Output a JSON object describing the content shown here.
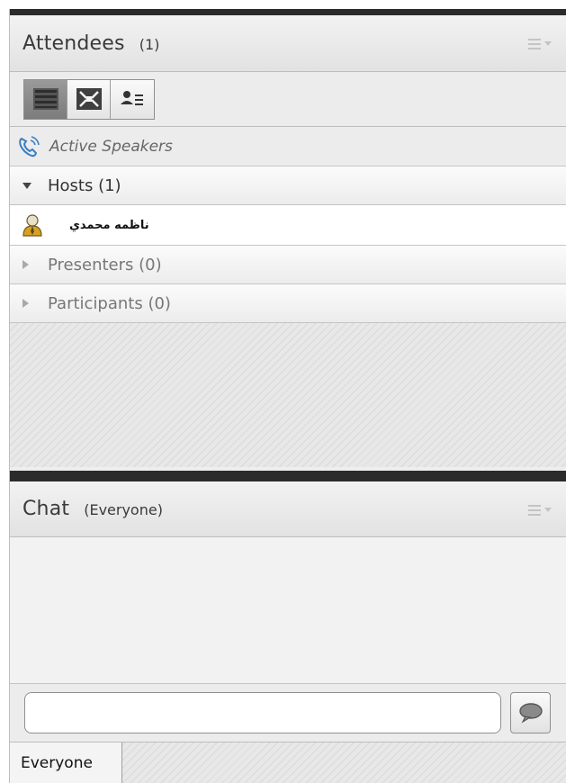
{
  "attendees": {
    "title": "Attendees",
    "count": "(1)",
    "view_buttons": [
      {
        "icon": "list-view-icon",
        "selected": true
      },
      {
        "icon": "breakout-view-icon",
        "selected": false
      },
      {
        "icon": "status-view-icon",
        "selected": false
      }
    ],
    "active_speakers": "Active Speakers",
    "groups": {
      "hosts": {
        "label": "Hosts (1)",
        "expanded": true
      },
      "presenters": {
        "label": "Presenters (0)",
        "expanded": false
      },
      "participants": {
        "label": "Participants (0)",
        "expanded": false
      }
    },
    "host_attendee": {
      "name": "ناظمه محمدي",
      "icon": "host-user-icon"
    }
  },
  "chat": {
    "title": "Chat",
    "scope": "(Everyone)",
    "input_value": "",
    "send_icon": "speech-bubble-icon",
    "recipient_tab": "Everyone"
  },
  "colors": {
    "header_bar": "#2b2b2b",
    "host_icon": "#d9a020",
    "phone_icon": "#3a7fc4"
  }
}
